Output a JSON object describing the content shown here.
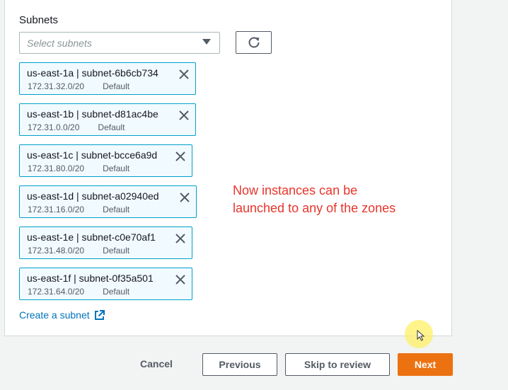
{
  "subnets_section": {
    "label": "Subnets",
    "select_placeholder": "Select subnets"
  },
  "tokens": [
    {
      "title": "us-east-1a | subnet-6b6cb734",
      "cidr": "172.31.32.0/20",
      "tag": "Default"
    },
    {
      "title": "us-east-1b | subnet-d81ac4be",
      "cidr": "172.31.0.0/20",
      "tag": "Default"
    },
    {
      "title": "us-east-1c | subnet-bcce6a9d",
      "cidr": "172.31.80.0/20",
      "tag": "Default"
    },
    {
      "title": "us-east-1d | subnet-a02940ed",
      "cidr": "172.31.16.0/20",
      "tag": "Default"
    },
    {
      "title": "us-east-1e | subnet-c0e70af1",
      "cidr": "172.31.48.0/20",
      "tag": "Default"
    },
    {
      "title": "us-east-1f | subnet-0f35a501",
      "cidr": "172.31.64.0/20",
      "tag": "Default"
    }
  ],
  "create_link": "Create a subnet",
  "annotation": {
    "line1": "Now instances can be",
    "line2": "launched to any of the zones"
  },
  "footer": {
    "cancel": "Cancel",
    "previous": "Previous",
    "skip": "Skip to review",
    "next": "Next"
  },
  "colors": {
    "accent": "#ec7211",
    "link": "#0073bb",
    "token_border": "#00a1c9",
    "token_bg": "#f1faff",
    "annotation": "#e8352c"
  },
  "icons": {
    "refresh": "refresh-icon",
    "remove": "close-icon",
    "external": "external-link-icon",
    "dropdown": "caret-down-icon"
  }
}
